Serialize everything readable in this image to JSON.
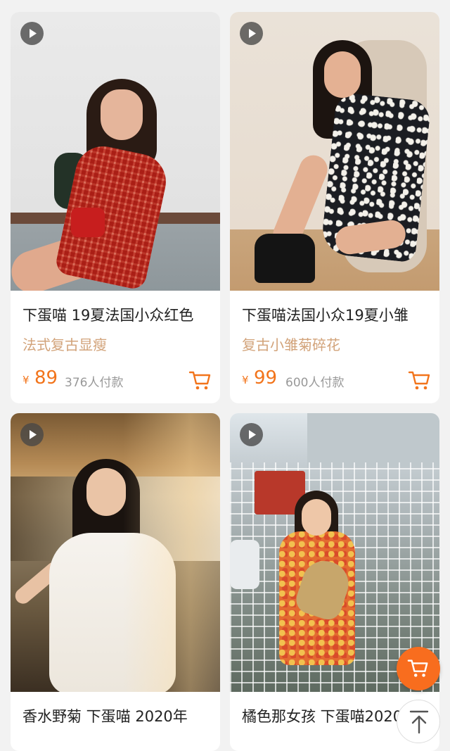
{
  "products": [
    {
      "title": "下蛋喵 19夏法国小众红色",
      "tag": "法式复古显瘦",
      "currency": "¥",
      "price": "89",
      "sold": "376人付款",
      "has_video": true
    },
    {
      "title": "下蛋喵法国小众19夏小雏",
      "tag": "复古小雏菊碎花",
      "currency": "¥",
      "price": "99",
      "sold": "600人付款",
      "has_video": true
    },
    {
      "title": "香水野菊 下蛋喵 2020年",
      "has_video": true
    },
    {
      "title": "橘色那女孩 下蛋喵2020",
      "has_video": true
    }
  ],
  "colors": {
    "accent": "#f2741b",
    "tag": "#d2a37a",
    "background": "#f2f2f2",
    "float_cart": "#f86d1e"
  },
  "icons": {
    "play": "play-icon",
    "cart": "cart-icon",
    "float_cart": "cart-icon",
    "back_to_top": "arrow-up-icon"
  }
}
